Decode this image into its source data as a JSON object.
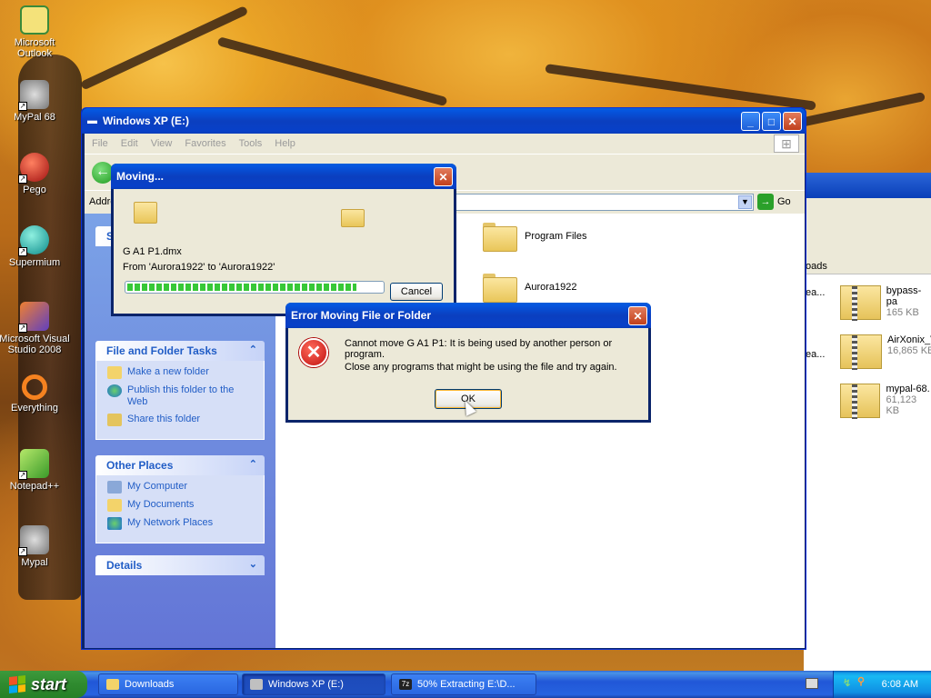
{
  "desktop": {
    "icons": [
      {
        "label": "Microsoft Outlook"
      },
      {
        "label": "MyPal 68"
      },
      {
        "label": "Pego"
      },
      {
        "label": "Supermium"
      },
      {
        "label": "Microsoft Visual Studio 2008"
      },
      {
        "label": "Everything"
      },
      {
        "label": "Notepad++"
      },
      {
        "label": "Mypal"
      }
    ]
  },
  "explorer": {
    "title": "Windows XP (E:)",
    "menu": [
      "File",
      "Edit",
      "View",
      "Favorites",
      "Tools",
      "Help"
    ],
    "address_label": "Addre",
    "go_label": "Go",
    "panels": {
      "file_tasks": {
        "title": "File and Folder Tasks",
        "items": [
          "Make a new folder",
          "Publish this folder to the Web",
          "Share this folder"
        ]
      },
      "other_places": {
        "title": "Other Places",
        "items": [
          "My Computer",
          "My Documents",
          "My Network Places"
        ]
      },
      "details": {
        "title": "Details"
      }
    },
    "collapsed_panel_initial": "S",
    "folders": [
      {
        "name": "Program Files"
      },
      {
        "name": "Aurora1922"
      }
    ]
  },
  "downloads_window": {
    "column_header": "oads",
    "left_fragments": [
      "ea...",
      "ea..."
    ],
    "files": [
      {
        "name": "bypass-pa",
        "size": "165 KB"
      },
      {
        "name": "AirXonix_V",
        "size": "16,865 KB"
      },
      {
        "name": "mypal-68.",
        "size": "61,123 KB"
      }
    ]
  },
  "moving_dialog": {
    "title": "Moving...",
    "file_name": "G A1 P1.dmx",
    "from_to": "From 'Aurora1922' to 'Aurora1922'",
    "cancel_label": "Cancel",
    "progress": 0.9
  },
  "error_dialog": {
    "title": "Error Moving File or Folder",
    "message": "Cannot move G A1 P1: It is being used by another person or program.",
    "hint": "Close any programs that might be using the file and try again.",
    "ok_label": "OK"
  },
  "taskbar": {
    "start_label": "start",
    "buttons": [
      {
        "label": "Downloads"
      },
      {
        "label": "Windows XP (E:)"
      },
      {
        "label": "50% Extracting E:\\D..."
      }
    ],
    "clock": "6:08 AM"
  },
  "colors": {
    "xp_title_blue": "#0b3fbf",
    "task_link": "#215dc6",
    "dialog_face": "#ece9d8",
    "progress_green": "#37c837"
  }
}
